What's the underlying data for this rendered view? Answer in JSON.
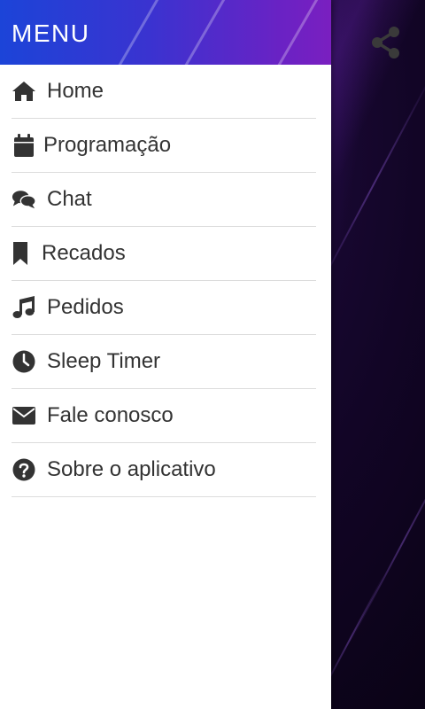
{
  "drawer": {
    "title": "MENU",
    "items": [
      {
        "label": "Home",
        "icon": "home-icon"
      },
      {
        "label": "Programação",
        "icon": "calendar-icon"
      },
      {
        "label": "Chat",
        "icon": "chat-icon"
      },
      {
        "label": "Recados",
        "icon": "bookmark-icon"
      },
      {
        "label": "Pedidos",
        "icon": "music-note-icon"
      },
      {
        "label": "Sleep Timer",
        "icon": "clock-icon"
      },
      {
        "label": "Fale conosco",
        "icon": "envelope-icon"
      },
      {
        "label": "Sobre o aplicativo",
        "icon": "question-circle-icon"
      }
    ]
  },
  "app": {
    "share_icon": "share-icon"
  },
  "colors": {
    "header_start": "#1c44d8",
    "header_end": "#7a1fc0",
    "text": "#333333",
    "divider": "#dcdcdc"
  }
}
